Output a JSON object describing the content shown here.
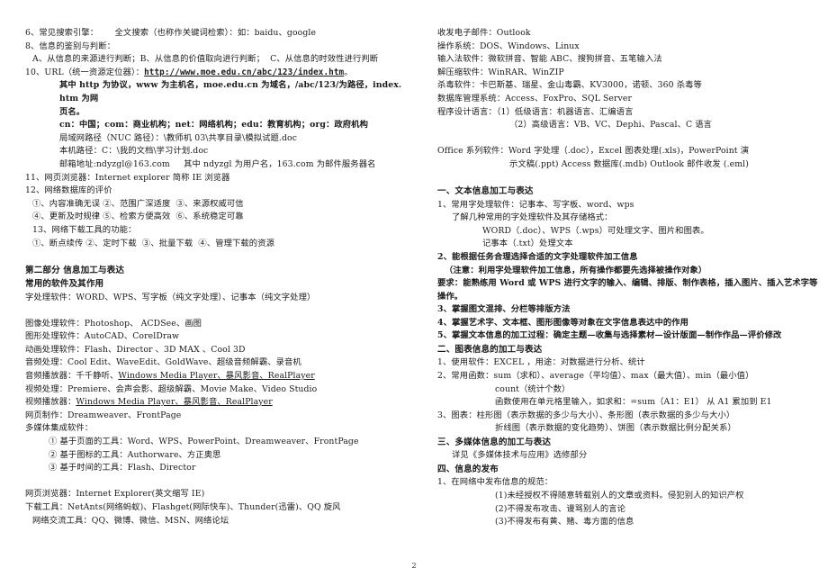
{
  "document": {
    "page_number": "2",
    "left_column": [
      {
        "id": "l1",
        "indent": 0,
        "style": "normal",
        "text": "6、常见搜索引擎：      全文搜索（也称作关键词检索）：如：baidu、google"
      },
      {
        "id": "l2",
        "indent": 0,
        "style": "normal",
        "text": "8、信息的鉴别与判断："
      },
      {
        "id": "l3",
        "indent": 1,
        "style": "normal",
        "text": "A、从信息的来源进行判断；B、从信息的价值取向进行判断；  C、从信息的时效性进行判断"
      },
      {
        "id": "l4",
        "indent": 0,
        "style": "url-line",
        "text_before": "10、URL（统一资源定位器）：",
        "url": "http://www.moe.edu.cn/abc/123/index.htm",
        "text_after": "。"
      },
      {
        "id": "l5",
        "indent": 4,
        "style": "bold",
        "text": "其中 http 为协议，www 为主机名，moe.edu.cn 为域名，/abc/123/为路径，index.htm 为网"
      },
      {
        "id": "l6",
        "indent": 4,
        "style": "bold",
        "text": "页名。"
      },
      {
        "id": "l7",
        "indent": 4,
        "style": "bold",
        "text": "cn：中国；com：商业机构；net：网络机构；edu：教育机构；org：政府机构"
      },
      {
        "id": "l8",
        "indent": 4,
        "style": "normal",
        "text": "局域网路径（NUC 路径）：\\教师机 03\\共享目录\\模拟试题.doc"
      },
      {
        "id": "l9",
        "indent": 4,
        "style": "normal",
        "text": "本机路径：C：\\我的文档\\学习计划.doc"
      },
      {
        "id": "l10",
        "indent": 4,
        "style": "normal",
        "text": "邮箱地址:ndyzgl@163.com     其中 ndyzgl 为用户名，163.com 为邮件服务器名"
      },
      {
        "id": "l11",
        "indent": 0,
        "style": "normal",
        "text": "11、网页浏览器：Internet explorer 简称 IE 浏览器"
      },
      {
        "id": "l12",
        "indent": 0,
        "style": "normal",
        "text": "12、网络数据库的评价"
      },
      {
        "id": "l13",
        "indent": 1,
        "style": "normal",
        "text": "①、内容准确无误 ②、范围广深适度  ③、来源权威可信"
      },
      {
        "id": "l14",
        "indent": 1,
        "style": "normal",
        "text": "④、更新及时规律 ⑤、检索方便高效  ⑥、系统稳定可靠"
      },
      {
        "id": "l15",
        "indent": 1,
        "style": "normal",
        "text": "13、网络下载工具的功能："
      },
      {
        "id": "l16",
        "indent": 1,
        "style": "normal",
        "text": "①、断点续传 ②、定时下载  ③、批量下载  ④、管理下载的资源"
      },
      {
        "id": "l17",
        "indent": 0,
        "style": "blank",
        "text": ""
      },
      {
        "id": "l18",
        "indent": 0,
        "style": "heading",
        "text": "第二部分 信息加工与表达"
      },
      {
        "id": "l19",
        "indent": 0,
        "style": "heading",
        "text": "常用的软件及其作用"
      },
      {
        "id": "l20",
        "indent": 0,
        "style": "normal",
        "text": "字处理软件：WORD、WPS、写字板（纯文字处理）、记事本（纯文字处理）"
      },
      {
        "id": "l21",
        "indent": 0,
        "style": "blank",
        "text": ""
      },
      {
        "id": "l22",
        "indent": 0,
        "style": "normal",
        "text": "图像处理软件：Photoshop、 ACDSee、画图"
      },
      {
        "id": "l23",
        "indent": 0,
        "style": "normal",
        "text": "图形处理软件：AutoCAD、CorelDraw"
      },
      {
        "id": "l24",
        "indent": 0,
        "style": "normal",
        "text": "动画处理软件：Flash、Director 、3D MAX 、Cool 3D"
      },
      {
        "id": "l25",
        "indent": 0,
        "style": "normal",
        "text": "音频处理：Cool Edit、WaveEdit、GoldWave、超级音频解霸、录音机"
      },
      {
        "id": "l26",
        "indent": 0,
        "style": "partial-underline",
        "text_before": "音频播放器：千千静听、",
        "underlined": "Windows Media Player、暴风影音、RealPlayer",
        "text_after": ""
      },
      {
        "id": "l27",
        "indent": 0,
        "style": "normal",
        "text": "视频处理：Premiere、会声会影、超级解霸、Movie Make、Video Studio"
      },
      {
        "id": "l28",
        "indent": 0,
        "style": "partial-underline",
        "text_before": "视频播放器：",
        "underlined": "Windows Media Player、暴风影音、RealPlayer",
        "text_after": ""
      },
      {
        "id": "l29",
        "indent": 0,
        "style": "normal",
        "text": "网页制作：Dreamweaver、FrontPage"
      },
      {
        "id": "l30",
        "indent": 0,
        "style": "normal",
        "text": "多媒体集成软件："
      },
      {
        "id": "l31",
        "indent": 3,
        "style": "normal",
        "text": "① 基于页面的工具：Word、WPS、PowerPoint、Dreamweaver、FrontPage"
      },
      {
        "id": "l32",
        "indent": 3,
        "style": "normal",
        "text": "② 基于图标的工具：Authorware、方正奥思"
      },
      {
        "id": "l33",
        "indent": 3,
        "style": "normal",
        "text": "③ 基于时间的工具：Flash、Director"
      },
      {
        "id": "l34",
        "indent": 0,
        "style": "blank",
        "text": ""
      },
      {
        "id": "l35",
        "indent": 0,
        "style": "normal",
        "text": "网页浏览器：Internet Explorer(英文缩写 IE)"
      },
      {
        "id": "l36",
        "indent": 0,
        "style": "normal",
        "text": "下载工具：NetAnts(网络蚂蚁)、Flashget(网际快车)、Thunder(迅雷)、QQ 旋风"
      },
      {
        "id": "l37",
        "indent": 1,
        "style": "normal",
        "text": "网络交流工具：QQ、微博、微信、MSN、网络论坛"
      }
    ],
    "right_column": [
      {
        "id": "r1",
        "indent": 0,
        "style": "normal",
        "text": "收发电子邮件：Outlook"
      },
      {
        "id": "r2",
        "indent": 0,
        "style": "normal",
        "text": "操作系统：DOS、Windows、Linux"
      },
      {
        "id": "r3",
        "indent": 0,
        "style": "normal",
        "text": "输入法软件：微软拼音、智能 ABC、搜狗拼音、五笔输入法"
      },
      {
        "id": "r4",
        "indent": 0,
        "style": "normal",
        "text": "解压缩软件：WinRAR、WinZIP"
      },
      {
        "id": "r5",
        "indent": 0,
        "style": "normal",
        "text": "杀毒软件：卡巴斯基、瑞星、金山毒霸、KV3000，诺顿、360 杀毒等"
      },
      {
        "id": "r6",
        "indent": 0,
        "style": "normal",
        "text": "数据库管理系统：Access、FoxPro、SQL Server"
      },
      {
        "id": "r7",
        "indent": 0,
        "style": "normal",
        "text": "程序设计语言：（1）低级语言：机器语言、汇编语言"
      },
      {
        "id": "r8",
        "indent": 7,
        "style": "normal",
        "text": "（2）高级语言：VB、VC、Dephi、Pascal、C 语言"
      },
      {
        "id": "r9",
        "indent": 0,
        "style": "blank",
        "text": ""
      },
      {
        "id": "r10",
        "indent": 0,
        "style": "normal",
        "text": "Office 系列软件：Word 字处理（.doc），Excel 图表处理(.xls)，PowerPoint 演"
      },
      {
        "id": "r11",
        "indent": 7,
        "style": "normal",
        "text": "示文稿(.ppt) Access 数据库(.mdb) Outlook 邮件收发 (.eml)"
      },
      {
        "id": "r12",
        "indent": 0,
        "style": "blank",
        "text": ""
      },
      {
        "id": "r13",
        "indent": 0,
        "style": "heading",
        "text": "一、文本信息加工与表达"
      },
      {
        "id": "r14",
        "indent": 0,
        "style": "normal",
        "text": "1、常用字处理软件：记事本、写字板、word、wps"
      },
      {
        "id": "r15",
        "indent": 2,
        "style": "normal",
        "text": "了解几种常用的字处理软件及其存储格式："
      },
      {
        "id": "r16",
        "indent": 5,
        "style": "normal",
        "text": "WORD（.doc）、WPS（.wps）可处理文字、图片和图表。"
      },
      {
        "id": "r17",
        "indent": 5,
        "style": "normal",
        "text": "记事本（.txt）处理文本"
      },
      {
        "id": "r18",
        "indent": 0,
        "style": "bold",
        "text": "2、能根据任务合理选择合适的文字处理软件加工信息"
      },
      {
        "id": "r19",
        "indent": 1,
        "style": "bold",
        "text": "（注意：利用字处理软件加工信息，所有操作都要先选择被操作对象）"
      },
      {
        "id": "r20",
        "indent": 0,
        "style": "bold",
        "text": "要求：能熟练用 Word 或 WPS 进行文字的输入、编辑、排版、制作表格，插入图片、插入艺术字等"
      },
      {
        "id": "r21",
        "indent": 0,
        "style": "bold",
        "text": "操作。"
      },
      {
        "id": "r22",
        "indent": 0,
        "style": "bold",
        "text": "3、掌握图文混排、分栏等排版方法"
      },
      {
        "id": "r23",
        "indent": 0,
        "style": "bold",
        "text": "4、掌握艺术字、文本框、图形图像等对象在文字信息表达中的作用"
      },
      {
        "id": "r24",
        "indent": 0,
        "style": "bold",
        "text": "5、掌握文本信息的加工过程：确定主题—收集与选择素材—设计版面—制作作品—评价修改"
      },
      {
        "id": "r25",
        "indent": 0,
        "style": "heading",
        "text": "二、图表信息的加工与表达"
      },
      {
        "id": "r26",
        "indent": 0,
        "style": "normal",
        "text": "1、使用软件：EXCEL ，用途：对数据进行分析、统计"
      },
      {
        "id": "r27",
        "indent": 0,
        "style": "normal",
        "text": "2、常用函数：sum（求和）、average（平均值）、max（最大值）、min（最小值）"
      },
      {
        "id": "r28",
        "indent": 6,
        "style": "normal",
        "text": "count（统计个数）"
      },
      {
        "id": "r29",
        "indent": 6,
        "style": "normal",
        "text": "函数使用在单元格里输入，如求和：=sum（A1：E1） 从 A1 累加到 E1"
      },
      {
        "id": "r30",
        "indent": 0,
        "style": "normal",
        "text": "3、图表：柱形图（表示数据的多少与大小）、条形图（表示数据的多少与大小）"
      },
      {
        "id": "r31",
        "indent": 6,
        "style": "normal",
        "text": "折线图（表示数据的变化趋势）、饼图（表示数据比例分配关系）"
      },
      {
        "id": "r32",
        "indent": 0,
        "style": "heading",
        "text": "三、多媒体信息的加工与表达"
      },
      {
        "id": "r33",
        "indent": 2,
        "style": "normal",
        "text": "详见《多媒体技术与应用》选修部分"
      },
      {
        "id": "r34",
        "indent": 0,
        "style": "heading",
        "text": "四、信息的发布"
      },
      {
        "id": "r35",
        "indent": 0,
        "style": "normal",
        "text": "1、在网络中发布信息的规范："
      },
      {
        "id": "r36",
        "indent": 6,
        "style": "normal",
        "text": "(1)未经授权不得随意转载别人的文章或资料。侵犯别人的知识产权"
      },
      {
        "id": "r37",
        "indent": 6,
        "style": "normal",
        "text": "(2)不得发布攻击、谩骂别人的言论"
      },
      {
        "id": "r38",
        "indent": 6,
        "style": "normal",
        "text": "(3)不得发布有黄、赌、毒方面的信息"
      }
    ]
  }
}
